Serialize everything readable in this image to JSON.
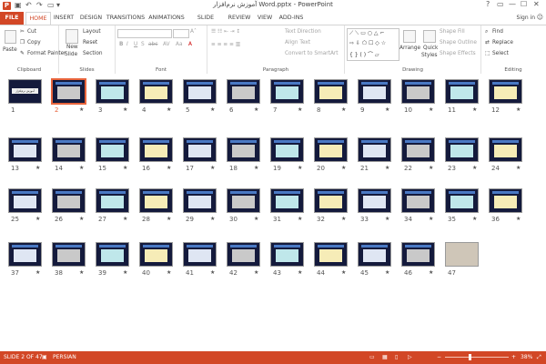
{
  "window": {
    "title": "آموزش نرم‌افزار Word.pptx - PowerPoint",
    "controls": [
      "?",
      "▭",
      "—",
      "☐",
      "✕"
    ]
  },
  "tabs": [
    "FILE",
    "HOME",
    "INSERT",
    "DESIGN",
    "TRANSITIONS",
    "ANIMATIONS",
    "SLIDE SHOW",
    "REVIEW",
    "VIEW",
    "ADD-INS"
  ],
  "active_tab": "HOME",
  "signin": "Sign in",
  "ribbon": {
    "clipboard": {
      "label": "Clipboard",
      "paste": "Paste",
      "cut": "Cut",
      "copy": "Copy",
      "format_painter": "Format Painter"
    },
    "slides": {
      "label": "Slides",
      "new_slide": "New",
      "new_slide2": "Slide",
      "layout": "Layout",
      "reset": "Reset",
      "section": "Section"
    },
    "font": {
      "label": "Font",
      "bold": "B",
      "italic": "I",
      "underline": "U",
      "shadow": "S",
      "strike": "abc",
      "spacing": "AV",
      "case": "Aa",
      "color": "A"
    },
    "paragraph": {
      "label": "Paragraph",
      "text_direction": "Text Direction",
      "align_text": "Align Text",
      "convert": "Convert to SmartArt"
    },
    "drawing": {
      "label": "Drawing",
      "arrange": "Arrange",
      "quick": "Quick",
      "styles": "Styles",
      "shape_fill": "Shape Fill",
      "shape_outline": "Shape Outline",
      "shape_effects": "Shape Effects"
    },
    "editing": {
      "label": "Editing",
      "find": "Find",
      "replace": "Replace",
      "select": "Select"
    }
  },
  "slides": [
    {
      "n": "1"
    },
    {
      "n": "2"
    },
    {
      "n": "3"
    },
    {
      "n": "4"
    },
    {
      "n": "5"
    },
    {
      "n": "6"
    },
    {
      "n": "7"
    },
    {
      "n": "8"
    },
    {
      "n": "9"
    },
    {
      "n": "10"
    },
    {
      "n": "11"
    },
    {
      "n": "12"
    },
    {
      "n": "13"
    },
    {
      "n": "14"
    },
    {
      "n": "15"
    },
    {
      "n": "16"
    },
    {
      "n": "17"
    },
    {
      "n": "18"
    },
    {
      "n": "19"
    },
    {
      "n": "20"
    },
    {
      "n": "21"
    },
    {
      "n": "22"
    },
    {
      "n": "23"
    },
    {
      "n": "24"
    },
    {
      "n": "25"
    },
    {
      "n": "26"
    },
    {
      "n": "27"
    },
    {
      "n": "28"
    },
    {
      "n": "29"
    },
    {
      "n": "30"
    },
    {
      "n": "31"
    },
    {
      "n": "32"
    },
    {
      "n": "33"
    },
    {
      "n": "34"
    },
    {
      "n": "35"
    },
    {
      "n": "36"
    },
    {
      "n": "37"
    },
    {
      "n": "38"
    },
    {
      "n": "39"
    },
    {
      "n": "40"
    },
    {
      "n": "41"
    },
    {
      "n": "42"
    },
    {
      "n": "43"
    },
    {
      "n": "44"
    },
    {
      "n": "45"
    },
    {
      "n": "46"
    },
    {
      "n": "47"
    }
  ],
  "selected_slide": "2",
  "slide1_title": "آموزش نرم‌افزار Word",
  "transition_mark": "★",
  "status": {
    "slide_of": "SLIDE 2 OF 47",
    "language": "PERSIAN",
    "zoom": "38%",
    "minus": "−",
    "plus": "+"
  },
  "colors": {
    "accent": "#d24726",
    "slide_bg": "#141a3c",
    "selection": "#e8643c"
  }
}
